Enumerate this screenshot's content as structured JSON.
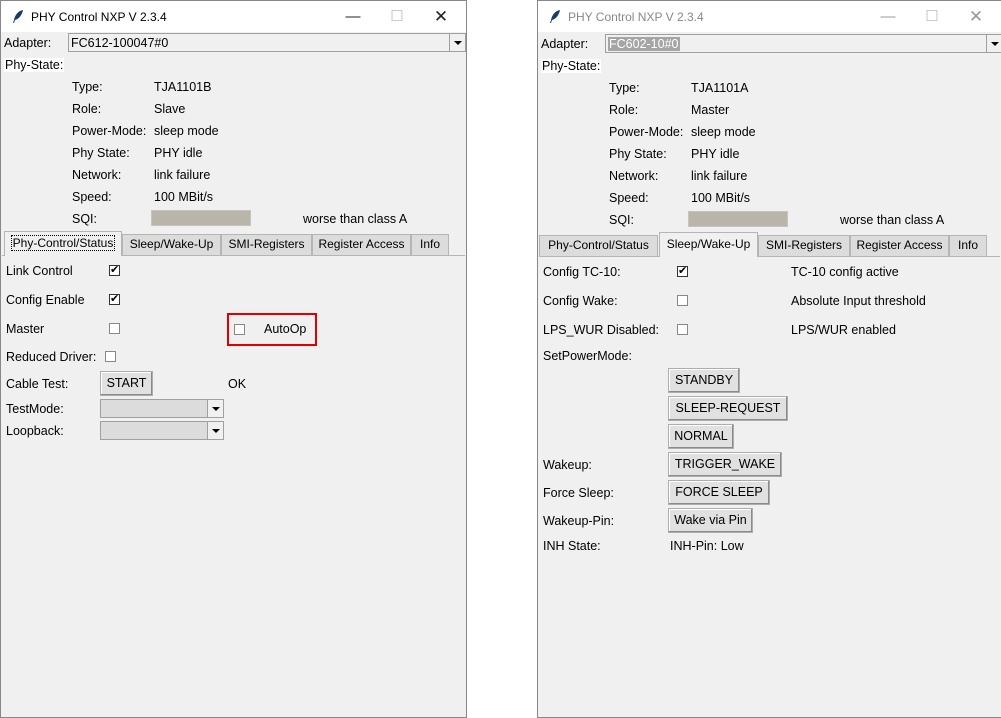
{
  "left": {
    "title": "PHY Control NXP V 2.3.4",
    "adapter_label": "Adapter:",
    "adapter_value": "FC612-100047#0",
    "phy_state_label": "Phy-State:",
    "rows": [
      {
        "label": "Type:",
        "value": "TJA1101B"
      },
      {
        "label": "Role:",
        "value": "Slave"
      },
      {
        "label": "Power-Mode:",
        "value": "sleep mode"
      },
      {
        "label": "Phy State:",
        "value": "PHY idle"
      },
      {
        "label": "Network:",
        "value": "link failure"
      },
      {
        "label": "Speed:",
        "value": "100 MBit/s"
      }
    ],
    "sqi_label": "SQI:",
    "sqi_text": "worse than class A",
    "tabs": [
      "Phy-Control/Status",
      "Sleep/Wake-Up",
      "SMI-Registers",
      "Register Access",
      "Info"
    ],
    "active_tab": "Phy-Control/Status",
    "panel": {
      "link_control": "Link Control",
      "config_enable": "Config Enable",
      "master": "Master",
      "autoop": "AutoOp",
      "reduced_driver": "Reduced Driver:",
      "cable_test": "Cable Test:",
      "start": "START",
      "cable_status": "OK",
      "test_mode": "TestMode:",
      "loopback": "Loopback:"
    }
  },
  "right": {
    "title": "PHY Control NXP V 2.3.4",
    "adapter_label": "Adapter:",
    "adapter_value": "FC602-10#0",
    "phy_state_label": "Phy-State:",
    "rows": [
      {
        "label": "Type:",
        "value": "TJA1101A"
      },
      {
        "label": "Role:",
        "value": "Master"
      },
      {
        "label": "Power-Mode:",
        "value": "sleep mode"
      },
      {
        "label": "Phy State:",
        "value": "PHY idle"
      },
      {
        "label": "Network:",
        "value": "link failure"
      },
      {
        "label": "Speed:",
        "value": "100 MBit/s"
      }
    ],
    "sqi_label": "SQI:",
    "sqi_text": "worse than class A",
    "tabs": [
      "Phy-Control/Status",
      "Sleep/Wake-Up",
      "SMI-Registers",
      "Register Access",
      "Info"
    ],
    "active_tab": "Sleep/Wake-Up",
    "panel": {
      "config_tc10": "Config TC-10:",
      "tc10_status": "TC-10 config active",
      "config_wake": "Config Wake:",
      "wake_status": "Absolute Input threshold",
      "lps_wur": "LPS_WUR Disabled:",
      "lps_status": "LPS/WUR enabled",
      "set_power_mode": "SetPowerMode:",
      "standby": "STANDBY",
      "sleep_request": "SLEEP-REQUEST",
      "normal": "NORMAL",
      "wakeup": "Wakeup:",
      "trigger_wake": "TRIGGER_WAKE",
      "force_sleep_label": "Force Sleep:",
      "force_sleep_btn": "FORCE SLEEP",
      "wakeup_pin": "Wakeup-Pin:",
      "wake_via_pin": "Wake via Pin",
      "inh_state": "INH State:",
      "inh_value": "INH-Pin: Low"
    }
  },
  "icons": {
    "app": "feather-icon",
    "minimize": "minimize-icon",
    "maximize": "maximize-icon",
    "close": "close-icon",
    "dropdown": "chevron-down-icon"
  },
  "colors": {
    "highlight": "#e00000",
    "window_bg": "#f0f0f0",
    "sqi_bar": "#bab5ab"
  }
}
